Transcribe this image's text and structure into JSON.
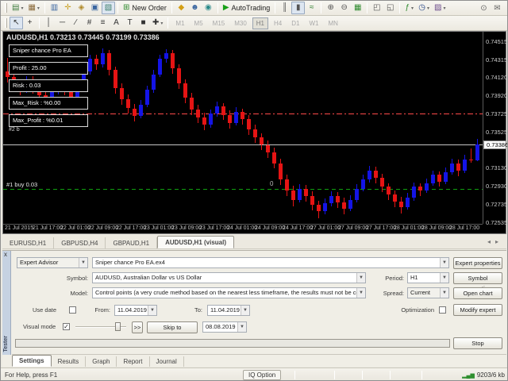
{
  "colors": {
    "bull": "#1414e6",
    "bear": "#e61414",
    "red_line": "#ff4a4a",
    "green_line": "#0fa00f",
    "white_line": "#c4c4c4"
  },
  "toolbar_main": {
    "items": [
      {
        "n": "new-chart-button",
        "g": "▤",
        "c": "#3f7d3f",
        "dd": true
      },
      {
        "n": "profiles-button",
        "g": "▦",
        "c": "#8a6a3a",
        "dd": true
      },
      {
        "sep": true
      },
      {
        "n": "market-watch-button",
        "g": "▥",
        "c": "#3a66a0"
      },
      {
        "n": "data-window-button",
        "g": "✛",
        "c": "#caa227"
      },
      {
        "n": "navigator-button",
        "g": "◈",
        "c": "#b08a2a"
      },
      {
        "n": "terminal-button",
        "g": "▣",
        "c": "#3a66a0"
      },
      {
        "n": "strategy-tester-button",
        "g": "▧",
        "c": "#3a7d6a",
        "pressed": true
      },
      {
        "sep": true
      },
      {
        "n": "new-order-button",
        "g": "⊞",
        "c": "#2e8b2e",
        "lbl": "New Order"
      },
      {
        "sep": true
      },
      {
        "n": "metaeditor-button",
        "g": "◆",
        "c": "#d4a017"
      },
      {
        "n": "community-button",
        "g": "☻",
        "c": "#3a66a0"
      },
      {
        "n": "market-button",
        "g": "◉",
        "c": "#2a8a8a"
      },
      {
        "sep": true
      },
      {
        "n": "autotrading-button",
        "g": "▶",
        "c": "#19a019",
        "lbl": "AutoTrading"
      },
      {
        "sep": true
      },
      {
        "n": "bar-chart-button",
        "g": "║",
        "c": "#555555"
      },
      {
        "n": "candlestick-chart-button",
        "g": "▮",
        "c": "#555555",
        "pressed": true
      },
      {
        "n": "line-chart-button",
        "g": "≈",
        "c": "#2a7d2a"
      },
      {
        "sep": true
      },
      {
        "n": "zoom-in-button",
        "g": "⊕",
        "c": "#555555"
      },
      {
        "n": "zoom-out-button",
        "g": "⊖",
        "c": "#555555"
      },
      {
        "n": "tile-windows-button",
        "g": "▦",
        "c": "#2e8b2e"
      },
      {
        "sep": true
      },
      {
        "n": "cascade-windows-button",
        "g": "◰",
        "c": "#555555"
      },
      {
        "n": "arrange-windows-button",
        "g": "◱",
        "c": "#555555"
      },
      {
        "sep": true
      },
      {
        "n": "indicators-button",
        "g": "ƒ",
        "c": "#2e8b2e",
        "dd": true
      },
      {
        "n": "periods-button",
        "g": "◷",
        "c": "#2a4a8a",
        "dd": true
      },
      {
        "n": "templates-button",
        "g": "▨",
        "c": "#6a4a8a",
        "dd": true
      }
    ],
    "right_items": [
      {
        "n": "search-icon",
        "g": "⊙",
        "c": "#666666"
      },
      {
        "n": "chat-icon",
        "g": "✉",
        "c": "#666666"
      }
    ]
  },
  "toolbar_tools": {
    "items": [
      {
        "n": "cursor-tool",
        "g": "↖",
        "c": "#333333",
        "pressed": true
      },
      {
        "n": "crosshair-tool",
        "g": "+",
        "c": "#333333"
      },
      {
        "sep": true
      },
      {
        "n": "vertical-line-tool",
        "g": "│",
        "c": "#333333"
      },
      {
        "n": "horizontal-line-tool",
        "g": "─",
        "c": "#333333"
      },
      {
        "n": "trendline-tool",
        "g": "∕",
        "c": "#333333"
      },
      {
        "n": "fibonacci-tool",
        "g": "#",
        "c": "#333333"
      },
      {
        "n": "channel-tool",
        "g": "≡",
        "c": "#333333"
      },
      {
        "n": "text-tool",
        "g": "A",
        "c": "#333333"
      },
      {
        "n": "label-tool",
        "g": "T",
        "c": "#333333"
      },
      {
        "n": "shapes-tool",
        "g": "■",
        "c": "#333333"
      },
      {
        "n": "arrows-tool",
        "g": "✚",
        "c": "#333333",
        "dd": true
      },
      {
        "sep": true
      }
    ],
    "timeframes": [
      {
        "label": "M1"
      },
      {
        "label": "M5"
      },
      {
        "label": "M15"
      },
      {
        "label": "M30"
      },
      {
        "label": "H1",
        "active": true
      },
      {
        "label": "H4"
      },
      {
        "label": "D1"
      },
      {
        "label": "W1"
      },
      {
        "label": "MN"
      }
    ]
  },
  "chart": {
    "title": "AUDUSD,H1 0.73213 0.73445 0.73199 0.73386",
    "info_labels": [
      "Sniper chance Pro EA",
      "Profit : 25.00",
      "Risk  : 0.03",
      "Max_Risk : %0.00",
      "Max_Profit : %0.01"
    ],
    "small_label": "#2 b",
    "trade_label": "#1 buy 0.03",
    "order_marker": "0",
    "current_price": "0.73386",
    "lines": {
      "red": 0.73725,
      "white": 0.73386,
      "green": 0.72894
    },
    "price_axis": [
      "0.74515",
      "0.74315",
      "0.74120",
      "0.73920",
      "0.73725",
      "0.73525",
      "0.73130",
      "0.72930",
      "0.72735",
      "0.72535"
    ],
    "time_axis": [
      "21 Jul 2015",
      "21 Jul 17:00",
      "22 Jul 01:00",
      "22 Jul 09:00",
      "22 Jul 17:00",
      "23 Jul 01:00",
      "23 Jul 09:00",
      "23 Jul 17:00",
      "24 Jul 01:00",
      "24 Jul 09:00",
      "24 Jul 17:00",
      "27 Jul 01:00",
      "27 Jul 09:00",
      "27 Jul 17:00",
      "28 Jul 01:00",
      "28 Jul 09:00",
      "28 Jul 17:00"
    ]
  },
  "chart_data": {
    "type": "candlestick",
    "symbol": "AUDUSD",
    "period": "H1",
    "ylim": [
      0.72515,
      0.74619
    ],
    "ohlc": [
      [
        0.7418,
        0.7433,
        0.7406,
        0.7412
      ],
      [
        0.7412,
        0.7417,
        0.7399,
        0.7405
      ],
      [
        0.7405,
        0.741,
        0.7392,
        0.7398
      ],
      [
        0.7398,
        0.7413,
        0.7395,
        0.7408
      ],
      [
        0.7408,
        0.7413,
        0.7394,
        0.74
      ],
      [
        0.74,
        0.7405,
        0.7386,
        0.7392
      ],
      [
        0.7392,
        0.7398,
        0.738,
        0.7386
      ],
      [
        0.7386,
        0.7401,
        0.7383,
        0.7396
      ],
      [
        0.7396,
        0.741,
        0.7393,
        0.7404
      ],
      [
        0.7404,
        0.7409,
        0.7392,
        0.7398
      ],
      [
        0.7398,
        0.7403,
        0.7384,
        0.739
      ],
      [
        0.739,
        0.7407,
        0.7387,
        0.7402
      ],
      [
        0.7402,
        0.7423,
        0.7399,
        0.7418
      ],
      [
        0.7418,
        0.7437,
        0.7415,
        0.7432
      ],
      [
        0.7432,
        0.7437,
        0.742,
        0.7426
      ],
      [
        0.7426,
        0.7444,
        0.7423,
        0.7438
      ],
      [
        0.7438,
        0.7442,
        0.7414,
        0.742
      ],
      [
        0.742,
        0.7424,
        0.7394,
        0.74
      ],
      [
        0.74,
        0.7405,
        0.7382,
        0.7388
      ],
      [
        0.7388,
        0.7393,
        0.7372,
        0.7378
      ],
      [
        0.7378,
        0.7383,
        0.7364,
        0.737
      ],
      [
        0.737,
        0.7387,
        0.7367,
        0.7382
      ],
      [
        0.7382,
        0.7403,
        0.7379,
        0.7398
      ],
      [
        0.7398,
        0.742,
        0.7395,
        0.7415
      ],
      [
        0.7415,
        0.7437,
        0.7412,
        0.7432
      ],
      [
        0.7432,
        0.7443,
        0.7428,
        0.7438
      ],
      [
        0.7438,
        0.7442,
        0.7416,
        0.7422
      ],
      [
        0.7422,
        0.7426,
        0.7399,
        0.7405
      ],
      [
        0.7405,
        0.741,
        0.7384,
        0.739
      ],
      [
        0.739,
        0.7395,
        0.7371,
        0.7377
      ],
      [
        0.7377,
        0.7382,
        0.7362,
        0.7368
      ],
      [
        0.7368,
        0.7373,
        0.7354,
        0.736
      ],
      [
        0.736,
        0.7377,
        0.7357,
        0.7372
      ],
      [
        0.7372,
        0.7385,
        0.7369,
        0.738
      ],
      [
        0.738,
        0.7384,
        0.7365,
        0.7371
      ],
      [
        0.7371,
        0.7376,
        0.7356,
        0.7362
      ],
      [
        0.7362,
        0.7379,
        0.7359,
        0.7374
      ],
      [
        0.7374,
        0.7378,
        0.736,
        0.7366
      ],
      [
        0.7366,
        0.7371,
        0.7349,
        0.7355
      ],
      [
        0.7355,
        0.736,
        0.734,
        0.7346
      ],
      [
        0.7346,
        0.7351,
        0.7332,
        0.7338
      ],
      [
        0.7338,
        0.7343,
        0.7324,
        0.733
      ],
      [
        0.733,
        0.7335,
        0.7312,
        0.7318
      ],
      [
        0.7318,
        0.7323,
        0.7294,
        0.73
      ],
      [
        0.73,
        0.7305,
        0.7282,
        0.7288
      ],
      [
        0.7288,
        0.7293,
        0.7271,
        0.7278
      ],
      [
        0.7278,
        0.7295,
        0.7275,
        0.729
      ],
      [
        0.729,
        0.7294,
        0.7276,
        0.7282
      ],
      [
        0.7282,
        0.7287,
        0.7266,
        0.7272
      ],
      [
        0.7272,
        0.7277,
        0.7258,
        0.7265
      ],
      [
        0.7265,
        0.7279,
        0.7262,
        0.7274
      ],
      [
        0.7274,
        0.7287,
        0.7271,
        0.7282
      ],
      [
        0.7282,
        0.7286,
        0.7269,
        0.7275
      ],
      [
        0.7275,
        0.728,
        0.7262,
        0.7268
      ],
      [
        0.7268,
        0.7283,
        0.7265,
        0.7278
      ],
      [
        0.7278,
        0.7295,
        0.7275,
        0.729
      ],
      [
        0.729,
        0.7305,
        0.7287,
        0.73
      ],
      [
        0.73,
        0.7315,
        0.7297,
        0.731
      ],
      [
        0.731,
        0.7314,
        0.7296,
        0.7302
      ],
      [
        0.7302,
        0.7306,
        0.7286,
        0.7292
      ],
      [
        0.7292,
        0.7296,
        0.7278,
        0.7284
      ],
      [
        0.7284,
        0.7288,
        0.727,
        0.7276
      ],
      [
        0.7276,
        0.7281,
        0.7263,
        0.727
      ],
      [
        0.727,
        0.7285,
        0.7267,
        0.728
      ],
      [
        0.728,
        0.7297,
        0.7277,
        0.7292
      ],
      [
        0.7292,
        0.7296,
        0.7282,
        0.7288
      ],
      [
        0.7288,
        0.7301,
        0.7285,
        0.7296
      ],
      [
        0.7296,
        0.731,
        0.7293,
        0.7305
      ],
      [
        0.7305,
        0.7309,
        0.7292,
        0.7298
      ],
      [
        0.7298,
        0.7313,
        0.7295,
        0.7308
      ],
      [
        0.7308,
        0.7323,
        0.7305,
        0.7318
      ],
      [
        0.7318,
        0.7322,
        0.7304,
        0.731
      ],
      [
        0.731,
        0.7327,
        0.7307,
        0.7322
      ],
      [
        0.7322,
        0.7334,
        0.7318,
        0.7321
      ],
      [
        0.73213,
        0.73445,
        0.73199,
        0.73386
      ]
    ]
  },
  "chart_tabs": {
    "tabs": [
      {
        "label": "EURUSD,H1"
      },
      {
        "label": "GBPUSD,H4"
      },
      {
        "label": "GBPAUD,H1"
      },
      {
        "label": "AUDUSD,H1 (visual)",
        "active": true
      }
    ],
    "scroll_left": "◂",
    "scroll_right": "▸"
  },
  "tester": {
    "side_label": "Tester",
    "close_label": "x",
    "expert_selector": "Expert Advisor",
    "expert_value": "Sniper chance Pro EA.ex4",
    "symbol_label": "Symbol:",
    "symbol_value": "AUDUSD, Australian Dollar vs US Dollar",
    "period_label": "Period:",
    "period_value": "H1",
    "model_label": "Model:",
    "model_value": "Control points (a very crude method based on the nearest less timeframe, the results must not be considered)",
    "spread_label": "Spread:",
    "spread_value": "Current",
    "use_date_label": "Use date",
    "from_label": "From:",
    "from_value": "11.04.2019",
    "to_label": "To:",
    "to_value": "11.04.2019",
    "optimization_label": "Optimization",
    "visual_mode_label": "Visual mode",
    "visual_mode_checked": "✓",
    "fast_forward_label": ">>",
    "skip_to_label": "Skip to",
    "skip_date_value": "08.08.2019",
    "buttons": {
      "expert_properties": "Expert properties",
      "symbol_properties": "Symbol properties",
      "open_chart": "Open chart",
      "modify_expert": "Modify expert",
      "stop": "Stop"
    },
    "tabs": [
      {
        "label": "Settings",
        "active": true
      },
      {
        "label": "Results"
      },
      {
        "label": "Graph"
      },
      {
        "label": "Report"
      },
      {
        "label": "Journal"
      }
    ]
  },
  "status_bar": {
    "help": "For Help, press F1",
    "broker": "IQ Option",
    "signal_icon": "▂▄▆",
    "data_usage": "9203/6 kb"
  }
}
